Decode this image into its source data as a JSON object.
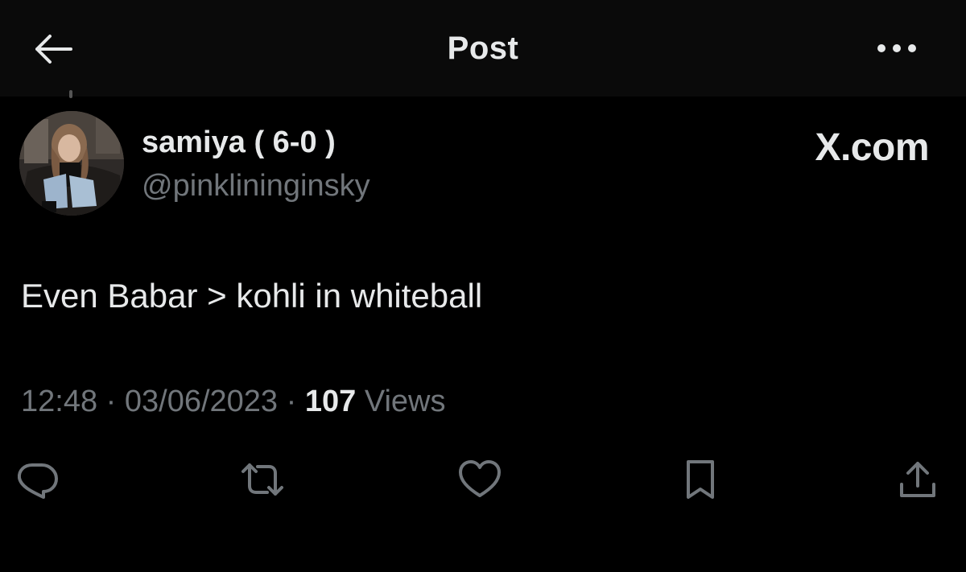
{
  "header": {
    "title": "Post",
    "back_icon": "arrow-left-icon",
    "more_icon": "more-horizontal-icon"
  },
  "author": {
    "display_name": "samiya ( 6-0 )",
    "handle": "@pinklininginsky"
  },
  "brand": "X.com",
  "tweet": {
    "text": "Even Babar > kohli in whiteball"
  },
  "meta": {
    "time": "12:48",
    "separator": "·",
    "date": "03/06/2023",
    "views_count": "107",
    "views_label": "Views"
  },
  "actions": [
    {
      "name": "reply",
      "icon": "reply-icon"
    },
    {
      "name": "repost",
      "icon": "repost-icon"
    },
    {
      "name": "like",
      "icon": "heart-icon"
    },
    {
      "name": "bookmark",
      "icon": "bookmark-icon"
    },
    {
      "name": "share",
      "icon": "share-icon"
    }
  ],
  "colors": {
    "background": "#000000",
    "header_background": "#0a0a0a",
    "primary_text": "#e7e9ea",
    "secondary_text": "#71767b"
  }
}
